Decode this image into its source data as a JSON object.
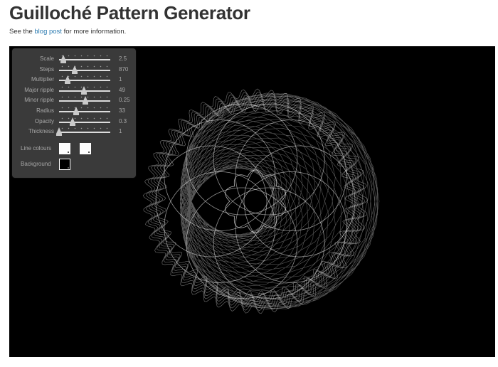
{
  "header": {
    "title": "Guilloché Pattern Generator",
    "subtitle_before": "See the ",
    "subtitle_link": "blog post",
    "subtitle_after": " for more information."
  },
  "controls": [
    {
      "id": "scale",
      "label": "Scale",
      "value": "2.5",
      "fraction": 0.08
    },
    {
      "id": "steps",
      "label": "Steps",
      "value": "870",
      "fraction": 0.31
    },
    {
      "id": "multiplier",
      "label": "Multiplier",
      "value": "1",
      "fraction": 0.17
    },
    {
      "id": "major-ripple",
      "label": "Major ripple",
      "value": "49",
      "fraction": 0.49
    },
    {
      "id": "minor-ripple",
      "label": "Minor ripple",
      "value": "0.25",
      "fraction": 0.51
    },
    {
      "id": "radius",
      "label": "Radius",
      "value": "33",
      "fraction": 0.33
    },
    {
      "id": "opacity",
      "label": "Opacity",
      "value": "0.3",
      "fraction": 0.27
    },
    {
      "id": "thickness",
      "label": "Thickness",
      "value": "1",
      "fraction": 0.0
    }
  ],
  "colours": {
    "line_label": "Line colours",
    "background_label": "Background",
    "line_colour_1": "#ffffff",
    "line_colour_2": "#ffffff",
    "background_colour": "#000000"
  },
  "pattern": {
    "stroke": "#ffffff",
    "background": "#000000"
  }
}
